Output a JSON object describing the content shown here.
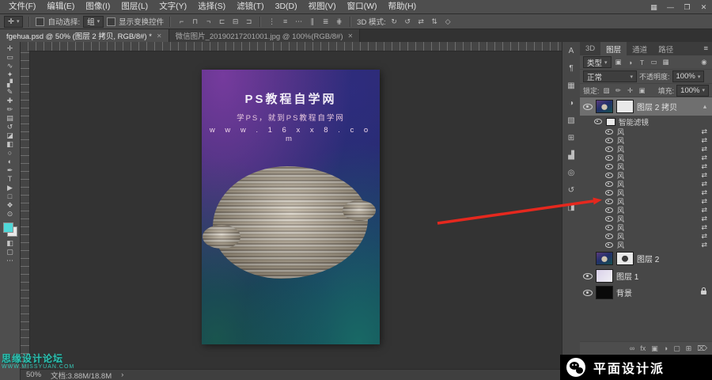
{
  "menu": {
    "items": [
      "文件(F)",
      "编辑(E)",
      "图像(I)",
      "图层(L)",
      "文字(Y)",
      "选择(S)",
      "滤镜(T)",
      "3D(D)",
      "视图(V)",
      "窗口(W)",
      "帮助(H)"
    ]
  },
  "window_controls": {
    "workspace": "▦",
    "minimize": "—",
    "restore": "❐",
    "close": "✕"
  },
  "ui": {
    "caret": "▾"
  },
  "options": {
    "tool_glyph": "✛",
    "auto_select_label": "自动选择:",
    "auto_select_value": "组",
    "show_transform_label": "显示变换控件",
    "align_icons": [
      "⌐",
      "⊓",
      "¬",
      "⊏",
      "⊟",
      "⊐"
    ],
    "distribute_icons": [
      "⋮",
      "≡",
      "⋯",
      "∥",
      "≣",
      "⋕"
    ],
    "mode_label": "3D 模式:",
    "mode_icons": [
      "↻",
      "↺",
      "⇄",
      "⇅",
      "◇"
    ]
  },
  "tabs": {
    "doc1": "fgehua.psd @ 50% (图层 2 拷贝, RGB/8#) *",
    "doc2": "微信图片_20190217201001.jpg @ 100%(RGB/8#)",
    "close": "✕"
  },
  "tools": [
    {
      "name": "move-tool",
      "glyph": "✛"
    },
    {
      "name": "rectangular-marquee-tool",
      "glyph": "▭"
    },
    {
      "name": "lasso-tool",
      "glyph": "∿"
    },
    {
      "name": "quick-selection-tool",
      "glyph": "✦"
    },
    {
      "name": "crop-tool",
      "glyph": "▞"
    },
    {
      "name": "eyedropper-tool",
      "glyph": "✎"
    },
    {
      "name": "spot-healing-brush-tool",
      "glyph": "✚"
    },
    {
      "name": "brush-tool",
      "glyph": "✏"
    },
    {
      "name": "clone-stamp-tool",
      "glyph": "▤"
    },
    {
      "name": "history-brush-tool",
      "glyph": "↺"
    },
    {
      "name": "eraser-tool",
      "glyph": "◪"
    },
    {
      "name": "gradient-tool",
      "glyph": "◧"
    },
    {
      "name": "blur-tool",
      "glyph": "○"
    },
    {
      "name": "dodge-tool",
      "glyph": "◐"
    },
    {
      "name": "pen-tool",
      "glyph": "✒"
    },
    {
      "name": "horizontal-type-tool",
      "glyph": "T"
    },
    {
      "name": "path-selection-tool",
      "glyph": "▶"
    },
    {
      "name": "rectangle-tool",
      "glyph": "□"
    },
    {
      "name": "hand-tool",
      "glyph": "❖"
    },
    {
      "name": "zoom-tool",
      "glyph": "⊙"
    }
  ],
  "toolbar_extra": {
    "quick_mask": "◧",
    "screen_mode": "▢",
    "more": "⋯"
  },
  "side_strip": [
    {
      "name": "character-panel-icon",
      "glyph": "A"
    },
    {
      "name": "paragraph-panel-icon",
      "glyph": "¶"
    },
    {
      "name": "swatches-panel-icon",
      "glyph": "▦"
    },
    {
      "name": "adjustments-panel-icon",
      "glyph": "◑"
    },
    {
      "name": "libraries-panel-icon",
      "glyph": "▧"
    },
    {
      "name": "clone-source-panel-icon",
      "glyph": "⊞"
    },
    {
      "name": "histogram-panel-icon",
      "glyph": "▟"
    },
    {
      "name": "navigator-panel-icon",
      "glyph": "◎"
    },
    {
      "name": "history-panel-icon",
      "glyph": "↺"
    },
    {
      "name": "properties-panel-icon",
      "glyph": "◨"
    }
  ],
  "doc": {
    "title": "PS教程自学网",
    "subtitle": "学PS，就到PS教程自学网",
    "url": "w w w . 1 6 x x 8 . c o m"
  },
  "panel": {
    "tabs": [
      "3D",
      "图层",
      "通道",
      "路径"
    ],
    "menu_icon": "≡",
    "filter_label": "类型",
    "filter_icons": [
      "▣",
      "◑",
      "T",
      "▭",
      "▦"
    ],
    "filter_toggle": "◉",
    "blend_mode": "正常",
    "opacity_label": "不透明度:",
    "opacity_value": "100%",
    "lock_label": "锁定:",
    "lock_icons": [
      "▨",
      "✏",
      "✛",
      "▣"
    ],
    "fill_label": "填充:",
    "fill_value": "100%",
    "layer_copy_name": "图层 2 拷贝",
    "collapse_icon": "▴",
    "smart_filter_label": "智能滤镜",
    "wind_icon": "⇄",
    "wind_labels": [
      "风",
      "风",
      "风",
      "风",
      "风",
      "风",
      "风",
      "风",
      "风",
      "风",
      "风",
      "风",
      "风",
      "风"
    ],
    "layer2_name": "图层 2",
    "layer1_name": "图层 1",
    "background_name": "背景",
    "bottom_icons": [
      {
        "name": "link-layers-icon",
        "glyph": "∞"
      },
      {
        "name": "layer-style-icon",
        "glyph": "fx"
      },
      {
        "name": "layer-mask-icon",
        "glyph": "▣"
      },
      {
        "name": "adjustment-layer-icon",
        "glyph": "◑"
      },
      {
        "name": "layer-group-icon",
        "glyph": "▢"
      },
      {
        "name": "new-layer-icon",
        "glyph": "⊞"
      },
      {
        "name": "delete-layer-icon",
        "glyph": "⌦"
      }
    ]
  },
  "status": {
    "zoom": "50%",
    "doc_info": "文档:3.88M/18.8M",
    "chevron": "›"
  },
  "wechat": {
    "name": "平面设计派"
  },
  "watermark": {
    "line1": "思缘设计论坛",
    "line2": "WWW.MISSYUAN.COM"
  }
}
